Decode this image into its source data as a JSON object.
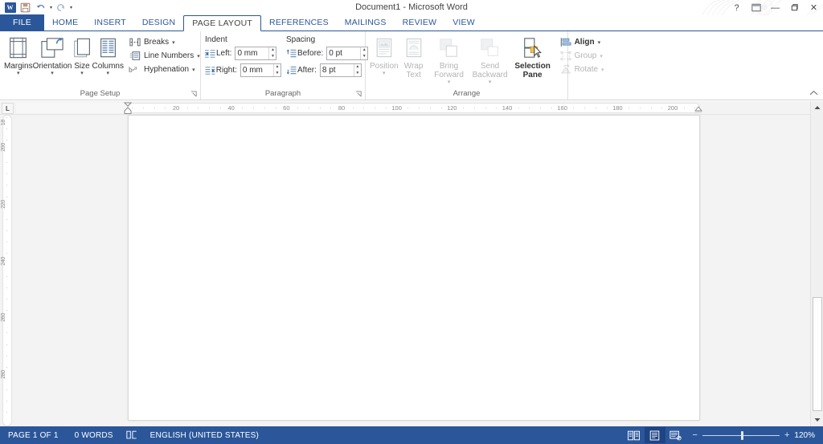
{
  "window": {
    "title": "Document1 - Microsoft Word",
    "controls": {
      "help": "?",
      "ribbon_options": "⊞",
      "minimize": "—",
      "restore": "❐",
      "close": "✕"
    }
  },
  "quick_access": {
    "app_icon": "W",
    "items": [
      {
        "name": "save",
        "glyph": "save-icon"
      },
      {
        "name": "undo",
        "glyph": "undo-icon"
      },
      {
        "name": "redo",
        "glyph": "redo-icon"
      },
      {
        "name": "customize",
        "glyph": "chevron-down-icon"
      }
    ]
  },
  "tabs": [
    {
      "label": "FILE",
      "active": false,
      "file": true
    },
    {
      "label": "HOME",
      "active": false
    },
    {
      "label": "INSERT",
      "active": false
    },
    {
      "label": "DESIGN",
      "active": false
    },
    {
      "label": "PAGE LAYOUT",
      "active": true
    },
    {
      "label": "REFERENCES",
      "active": false
    },
    {
      "label": "MAILINGS",
      "active": false
    },
    {
      "label": "REVIEW",
      "active": false
    },
    {
      "label": "VIEW",
      "active": false
    }
  ],
  "ribbon": {
    "collapse_label": "^",
    "groups": [
      {
        "name": "page-setup",
        "label": "Page Setup",
        "has_launcher": true,
        "big_buttons": [
          {
            "label": "Margins",
            "icon": "margins-icon",
            "dropdown": true,
            "disabled": false
          },
          {
            "label": "Orientation",
            "icon": "orientation-icon",
            "dropdown": true,
            "disabled": false
          },
          {
            "label": "Size",
            "icon": "size-icon",
            "dropdown": true,
            "disabled": false
          },
          {
            "label": "Columns",
            "icon": "columns-icon",
            "dropdown": true,
            "disabled": false
          }
        ],
        "small_buttons": [
          {
            "label": "Breaks",
            "icon": "breaks-icon",
            "dropdown": true,
            "disabled": false
          },
          {
            "label": "Line Numbers",
            "icon": "line-numbers-icon",
            "dropdown": true,
            "disabled": false
          },
          {
            "label": "Hyphenation",
            "icon": "hyphenation-icon",
            "dropdown": true,
            "disabled": false
          }
        ]
      },
      {
        "name": "paragraph",
        "label": "Paragraph",
        "has_launcher": true,
        "indent_header": "Indent",
        "spacing_header": "Spacing",
        "fields": [
          {
            "label": "Left:",
            "value": "0 mm",
            "icon": "indent-left-icon"
          },
          {
            "label": "Right:",
            "value": "0 mm",
            "icon": "indent-right-icon"
          },
          {
            "label": "Before:",
            "value": "0 pt",
            "icon": "spacing-before-icon"
          },
          {
            "label": "After:",
            "value": "8 pt",
            "icon": "spacing-after-icon"
          }
        ]
      },
      {
        "name": "arrange",
        "label": "Arrange",
        "has_launcher": false,
        "big_buttons": [
          {
            "label": "Position",
            "icon": "position-icon",
            "dropdown": true,
            "disabled": true
          },
          {
            "label": "Wrap Text",
            "icon": "wrap-text-icon",
            "dropdown": true,
            "disabled": true
          },
          {
            "label": "Bring Forward",
            "icon": "bring-forward-icon",
            "dropdown": true,
            "disabled": true
          },
          {
            "label": "Send Backward",
            "icon": "send-backward-icon",
            "dropdown": true,
            "disabled": true
          },
          {
            "label": "Selection Pane",
            "icon": "selection-pane-icon",
            "dropdown": false,
            "disabled": false
          }
        ],
        "small_buttons": [
          {
            "label": "Align",
            "icon": "align-icon",
            "dropdown": true,
            "disabled": false
          },
          {
            "label": "Group",
            "icon": "group-icon",
            "dropdown": true,
            "disabled": true
          },
          {
            "label": "Rotate",
            "icon": "rotate-icon",
            "dropdown": true,
            "disabled": true
          }
        ]
      }
    ]
  },
  "ruler": {
    "corner_tab_stop": "L",
    "horizontal_unit": "mm",
    "horizontal_ticks": [
      20,
      40,
      60,
      80,
      100,
      120,
      140,
      160,
      180,
      200
    ],
    "vertical_ticks": [
      200,
      220,
      240,
      260,
      280
    ],
    "left_indent_marker": "first-line-indent-marker",
    "right_indent_marker": "right-indent-marker"
  },
  "document": {
    "page_count": 1,
    "content": ""
  },
  "status_bar": {
    "page_indicator": "PAGE 1 OF 1",
    "word_count": "0 WORDS",
    "proofing_icon": "proofing-errors-icon",
    "language": "ENGLISH (UNITED STATES)",
    "views": [
      {
        "name": "read-mode",
        "label": "Read Mode",
        "active": false
      },
      {
        "name": "print-layout",
        "label": "Print Layout",
        "active": true
      },
      {
        "name": "web-layout",
        "label": "Web Layout",
        "active": false
      }
    ],
    "zoom_out": "−",
    "zoom_in": "+",
    "zoom_level": "120%"
  },
  "colors": {
    "brand": "#2b579a",
    "ribbon_bg": "#ffffff",
    "canvas": "#f3f3f3",
    "page": "#ffffff"
  }
}
